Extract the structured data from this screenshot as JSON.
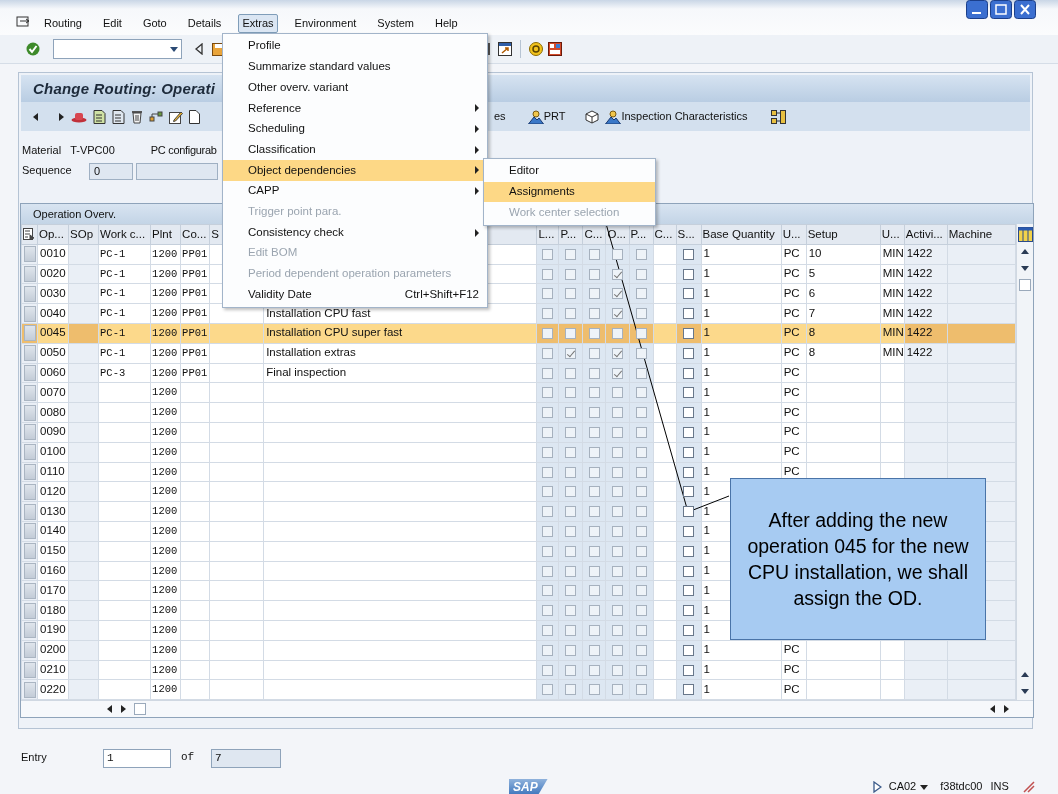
{
  "menu_bar": [
    {
      "label": "Routing",
      "selected": false
    },
    {
      "label": "Edit",
      "selected": false
    },
    {
      "label": "Goto",
      "selected": false
    },
    {
      "label": "Details",
      "selected": false
    },
    {
      "label": "Extras",
      "selected": true
    },
    {
      "label": "Environment",
      "selected": false
    },
    {
      "label": "System",
      "selected": false
    },
    {
      "label": "Help",
      "selected": false
    }
  ],
  "screen_title": "Change Routing: Operati",
  "app_toolbar": {
    "cut_label": "es",
    "prt_button": "PRT",
    "inspection_button": "Inspection Characteristics"
  },
  "header": {
    "material_label": "Material",
    "material": "T-VPC00",
    "description": "PC configurab",
    "sequence_label": "Sequence",
    "sequence": "0"
  },
  "table": {
    "title": "Operation Overv.",
    "columns_left": [
      "Op...",
      "SOp",
      "Work c...",
      "Plnt",
      "Co...",
      "S"
    ],
    "columns_right": [
      "L...",
      "P...",
      "C...",
      "O...",
      "P...",
      "C...",
      "S...",
      "Base Quantity",
      "U...",
      "Setup",
      "U...",
      "Activi...",
      "Machine"
    ],
    "rows": [
      {
        "op": "0010",
        "work_center": "PC-1",
        "plant": "1200",
        "control_key": "PP01",
        "checks": [
          false,
          false,
          false,
          false,
          false,
          false
        ],
        "base_quantity": "1",
        "unit": "PC",
        "setup": "10",
        "setup_unit": "MIN",
        "activity": "1422",
        "selected": false
      },
      {
        "op": "0020",
        "work_center": "PC-1",
        "plant": "1200",
        "control_key": "PP01",
        "checks": [
          false,
          false,
          false,
          true,
          false,
          false
        ],
        "base_quantity": "1",
        "unit": "PC",
        "setup": "5",
        "setup_unit": "MIN",
        "activity": "1422",
        "selected": false
      },
      {
        "op": "0030",
        "work_center": "PC-1",
        "plant": "1200",
        "control_key": "PP01",
        "checks": [
          false,
          false,
          false,
          true,
          false,
          false
        ],
        "base_quantity": "1",
        "unit": "PC",
        "setup": "6",
        "setup_unit": "MIN",
        "activity": "1422",
        "selected": false
      },
      {
        "op": "0040",
        "work_center": "PC-1",
        "plant": "1200",
        "control_key": "PP01",
        "description": "Installation CPU fast",
        "checks": [
          false,
          false,
          false,
          true,
          false,
          false
        ],
        "base_quantity": "1",
        "unit": "PC",
        "setup": "7",
        "setup_unit": "MIN",
        "activity": "1422",
        "selected": false
      },
      {
        "op": "0045",
        "work_center": "PC-1",
        "plant": "1200",
        "control_key": "PP01",
        "description": "Installation CPU super fast",
        "checks": [
          false,
          false,
          false,
          false,
          false,
          false
        ],
        "base_quantity": "1",
        "unit": "PC",
        "setup": "8",
        "setup_unit": "MIN",
        "activity": "1422",
        "selected": true
      },
      {
        "op": "0050",
        "work_center": "PC-1",
        "plant": "1200",
        "control_key": "PP01",
        "description": "Installation extras",
        "checks": [
          false,
          true,
          false,
          true,
          false,
          false
        ],
        "base_quantity": "1",
        "unit": "PC",
        "setup": "8",
        "setup_unit": "MIN",
        "activity": "1422",
        "selected": false
      },
      {
        "op": "0060",
        "work_center": "PC-3",
        "plant": "1200",
        "control_key": "PP01",
        "description": "Final inspection",
        "checks": [
          false,
          false,
          false,
          true,
          false,
          false
        ],
        "base_quantity": "1",
        "unit": "PC",
        "selected": false
      },
      {
        "op": "0070",
        "plant": "1200",
        "checks": [
          false,
          false,
          false,
          false,
          false,
          false
        ],
        "base_quantity": "1",
        "unit": "PC",
        "selected": false
      },
      {
        "op": "0080",
        "plant": "1200",
        "checks": [
          false,
          false,
          false,
          false,
          false,
          false
        ],
        "base_quantity": "1",
        "unit": "PC",
        "selected": false
      },
      {
        "op": "0090",
        "plant": "1200",
        "checks": [
          false,
          false,
          false,
          false,
          false,
          false
        ],
        "base_quantity": "1",
        "unit": "PC",
        "selected": false
      },
      {
        "op": "0100",
        "plant": "1200",
        "checks": [
          false,
          false,
          false,
          false,
          false,
          false
        ],
        "base_quantity": "1",
        "unit": "PC",
        "selected": false
      },
      {
        "op": "0110",
        "plant": "1200",
        "checks": [
          false,
          false,
          false,
          false,
          false,
          false
        ],
        "base_quantity": "1",
        "unit": "PC",
        "selected": false
      },
      {
        "op": "0120",
        "plant": "1200",
        "checks": [
          false,
          false,
          false,
          false,
          false,
          false
        ],
        "base_quantity": "1",
        "selected": false
      },
      {
        "op": "0130",
        "plant": "1200",
        "checks": [
          false,
          false,
          false,
          false,
          false,
          false
        ],
        "base_quantity": "1",
        "selected": false
      },
      {
        "op": "0140",
        "plant": "1200",
        "checks": [
          false,
          false,
          false,
          false,
          false,
          false
        ],
        "base_quantity": "1",
        "selected": false
      },
      {
        "op": "0150",
        "plant": "1200",
        "checks": [
          false,
          false,
          false,
          false,
          false,
          false
        ],
        "base_quantity": "1",
        "selected": false
      },
      {
        "op": "0160",
        "plant": "1200",
        "checks": [
          false,
          false,
          false,
          false,
          false,
          false
        ],
        "base_quantity": "1",
        "selected": false
      },
      {
        "op": "0170",
        "plant": "1200",
        "checks": [
          false,
          false,
          false,
          false,
          false,
          false
        ],
        "base_quantity": "1",
        "selected": false
      },
      {
        "op": "0180",
        "plant": "1200",
        "checks": [
          false,
          false,
          false,
          false,
          false,
          false
        ],
        "base_quantity": "1",
        "selected": false
      },
      {
        "op": "0190",
        "plant": "1200",
        "checks": [
          false,
          false,
          false,
          false,
          false,
          false
        ],
        "base_quantity": "1",
        "selected": false
      },
      {
        "op": "0200",
        "plant": "1200",
        "checks": [
          false,
          false,
          false,
          false,
          false,
          false
        ],
        "base_quantity": "1",
        "unit": "PC",
        "selected": false
      },
      {
        "op": "0210",
        "plant": "1200",
        "checks": [
          false,
          false,
          false,
          false,
          false,
          false
        ],
        "base_quantity": "1",
        "unit": "PC",
        "selected": false
      },
      {
        "op": "0220",
        "plant": "1200",
        "checks": [
          false,
          false,
          false,
          false,
          false,
          false
        ],
        "base_quantity": "1",
        "unit": "PC",
        "selected": false
      }
    ]
  },
  "entry": {
    "label": "Entry",
    "value": "1",
    "of_label": "of",
    "total": "7"
  },
  "extras_menu": [
    {
      "label": "Profile",
      "has_submenu": false,
      "disabled": false,
      "selected": false
    },
    {
      "label": "Summarize standard values",
      "has_submenu": false,
      "disabled": false,
      "selected": false
    },
    {
      "label": "Other overv. variant",
      "has_submenu": false,
      "disabled": false,
      "selected": false
    },
    {
      "label": "Reference",
      "has_submenu": true,
      "disabled": false,
      "selected": false
    },
    {
      "label": "Scheduling",
      "has_submenu": true,
      "disabled": false,
      "selected": false
    },
    {
      "label": "Classification",
      "has_submenu": true,
      "disabled": false,
      "selected": false
    },
    {
      "label": "Object dependencies",
      "has_submenu": true,
      "disabled": false,
      "selected": true
    },
    {
      "label": "CAPP",
      "has_submenu": true,
      "disabled": false,
      "selected": false
    },
    {
      "label": "Trigger point para.",
      "has_submenu": false,
      "disabled": true,
      "selected": false
    },
    {
      "label": "Consistency check",
      "has_submenu": true,
      "disabled": false,
      "selected": false
    },
    {
      "label": "Edit BOM",
      "has_submenu": false,
      "disabled": true,
      "selected": false
    },
    {
      "label": "Period dependent operation parameters",
      "has_submenu": false,
      "disabled": true,
      "selected": false
    },
    {
      "label": "Validity Date",
      "shortcut": "Ctrl+Shift+F12",
      "has_submenu": false,
      "disabled": false,
      "selected": false
    }
  ],
  "submenu": [
    {
      "label": "Editor",
      "disabled": false,
      "selected": false
    },
    {
      "label": "Assignments",
      "disabled": false,
      "selected": true
    },
    {
      "label": "Work center selection",
      "disabled": true,
      "selected": false
    }
  ],
  "callout": "After adding the new operation 045 for the new CPU installation, we shall assign the OD.",
  "status_bar": {
    "logo": "SAP",
    "transaction": "CA02",
    "server": "f38tdc00",
    "mode": "INS"
  }
}
